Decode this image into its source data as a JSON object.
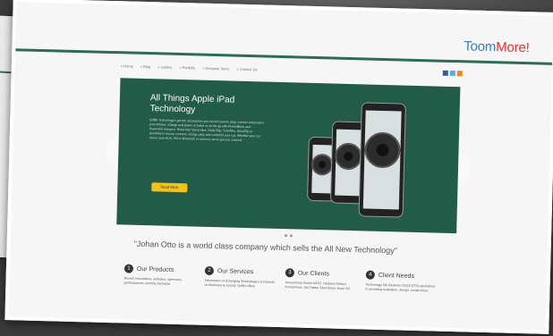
{
  "site": {
    "logo_part1": "Toom",
    "logo_part2": "More!",
    "nav": [
      "» Home",
      "» Blog",
      "» Gallery",
      "» Portfolio",
      "» Designer Items",
      "» Contact Us"
    ],
    "social_icons": [
      "facebook-icon",
      "twitter-icon",
      "rss-icon"
    ]
  },
  "banner": {
    "title": "All Things Apple iPad Technology",
    "body": "Griffin Technology's got the accessories you need to power, play, connect and protect your iPhone. Charge and power at home or on the go with PowerBlock and PowerJolt chargers. Road trip? Great idea. Grab iTrip, TuneFlex, WoodTip or AutoPilot to mount, connect, charge, play and control in your car. Whether your car stereo uses AUX, FM or Bluetooth to connect, we've got you covered.",
    "button": "Read More"
  },
  "quote": "\"Johan Otto is a world class company which sells the All New Technology\"",
  "columns": [
    {
      "num": "1",
      "title": "Our Products",
      "text": "Recent innovations, websites, speeches, performances, and the moments"
    },
    {
      "num": "2",
      "title": "Our Services",
      "text": "Information on Emerging Technologies & Impacts on Business & society. Griffin offers"
    },
    {
      "num": "3",
      "title": "Our Clients",
      "text": "Anonymous Hacks NATO, Hackers Deface Anonymous. Sat Twitter Sites Bruce Hope Sri"
    },
    {
      "num": "4",
      "title": "Client Needs",
      "text": "Technology Ols Reviews (TGO) (ITS) specializes in providing evaluation, design, construction,"
    }
  ],
  "colors": {
    "accent_green": "#235b49",
    "logo_blue": "#3b7fb4",
    "logo_red": "#e0302c",
    "button_yellow": "#f1c31a"
  }
}
